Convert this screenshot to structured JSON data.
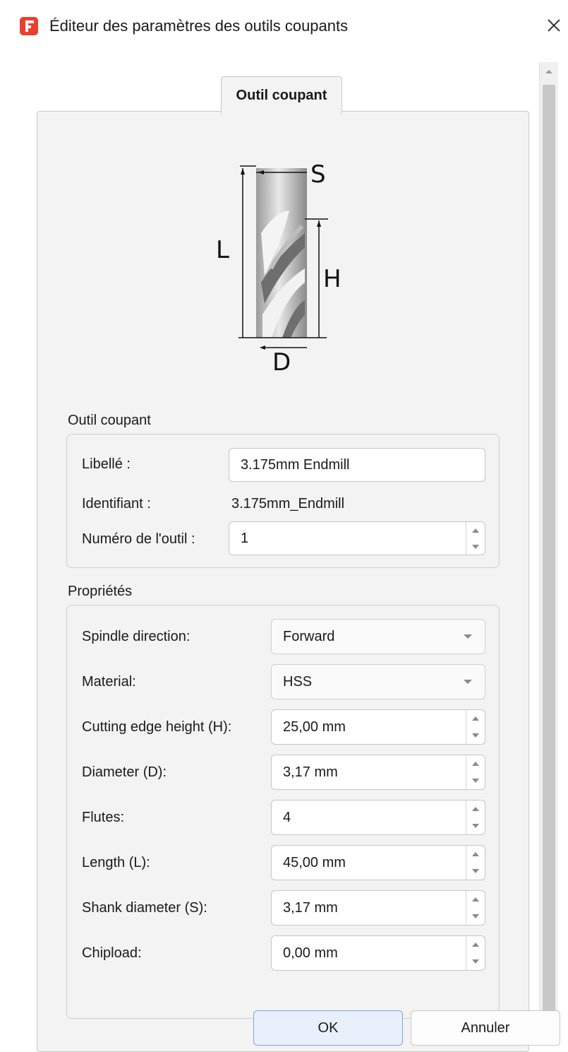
{
  "window": {
    "title": "Éditeur des paramètres des outils coupants"
  },
  "tab": {
    "label": "Outil coupant"
  },
  "diagram": {
    "labels": {
      "S": "S",
      "L": "L",
      "H": "H",
      "D": "D"
    }
  },
  "tool_group": {
    "title": "Outil coupant",
    "label_field": {
      "label": "Libellé :",
      "value": "3.175mm Endmill"
    },
    "id_field": {
      "label": "Identifiant :",
      "value": "3.175mm_Endmill"
    },
    "number_field": {
      "label": "Numéro de l'outil :",
      "value": "1"
    }
  },
  "properties_group": {
    "title": "Propriétés",
    "rows": [
      {
        "label": "Spindle direction:",
        "value": "Forward",
        "kind": "combo"
      },
      {
        "label": "Material:",
        "value": "HSS",
        "kind": "combo"
      },
      {
        "label": "Cutting edge height (H):",
        "value": "25,00 mm",
        "kind": "spin"
      },
      {
        "label": "Diameter (D):",
        "value": "3,17 mm",
        "kind": "spin"
      },
      {
        "label": "Flutes:",
        "value": "4",
        "kind": "spin"
      },
      {
        "label": "Length (L):",
        "value": "45,00 mm",
        "kind": "spin"
      },
      {
        "label": "Shank diameter (S):",
        "value": "3,17 mm",
        "kind": "spin"
      },
      {
        "label": "Chipload:",
        "value": "0,00 mm",
        "kind": "spin"
      }
    ]
  },
  "buttons": {
    "ok": "OK",
    "cancel": "Annuler"
  },
  "icons": {
    "app": "freecad-logo-icon",
    "close": "close-icon",
    "spin_up": "spin-up-icon",
    "spin_down": "spin-down-icon",
    "dropdown": "chevron-down-icon"
  },
  "colors": {
    "accent": "#e8402e",
    "ok_button": "#e8f0fb"
  }
}
